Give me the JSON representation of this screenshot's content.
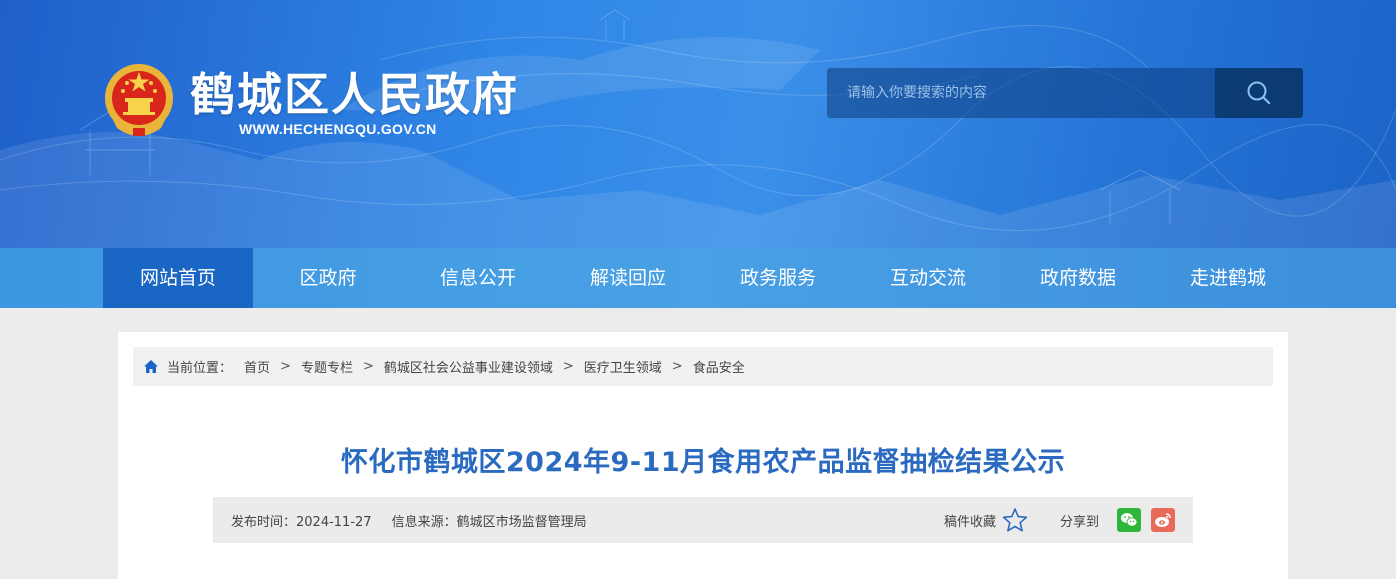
{
  "header": {
    "site_title": "鹤城区人民政府",
    "site_url": "WWW.HECHENGQU.GOV.CN",
    "search_placeholder": "请输入你要搜索的内容"
  },
  "nav": {
    "items": [
      {
        "label": "网站首页",
        "active": true
      },
      {
        "label": "区政府"
      },
      {
        "label": "信息公开"
      },
      {
        "label": "解读回应"
      },
      {
        "label": "政务服务"
      },
      {
        "label": "互动交流"
      },
      {
        "label": "政府数据"
      },
      {
        "label": "走进鹤城"
      }
    ]
  },
  "breadcrumb": {
    "label": "当前位置：",
    "items": [
      "首页",
      "专题专栏",
      "鹤城区社会公益事业建设领域",
      "医疗卫生领域",
      "食品安全"
    ],
    "separator": ">"
  },
  "article": {
    "title": "怀化市鹤城区2024年9-11月食用农产品监督抽检结果公示",
    "publish_time": "发布时间：2024-11-27",
    "source": "信息来源：鹤城区市场监督管理局",
    "collect_label": "稿件收藏",
    "share_label": "分享到"
  },
  "colors": {
    "nav_active": "#1a66c4",
    "title_blue": "#2a6ac0",
    "wechat_green": "#2fb63a",
    "weibo_red": "#e86a5a"
  },
  "icons": [
    "national-emblem-icon",
    "search-icon",
    "home-icon",
    "star-icon",
    "wechat-icon",
    "weibo-icon"
  ]
}
